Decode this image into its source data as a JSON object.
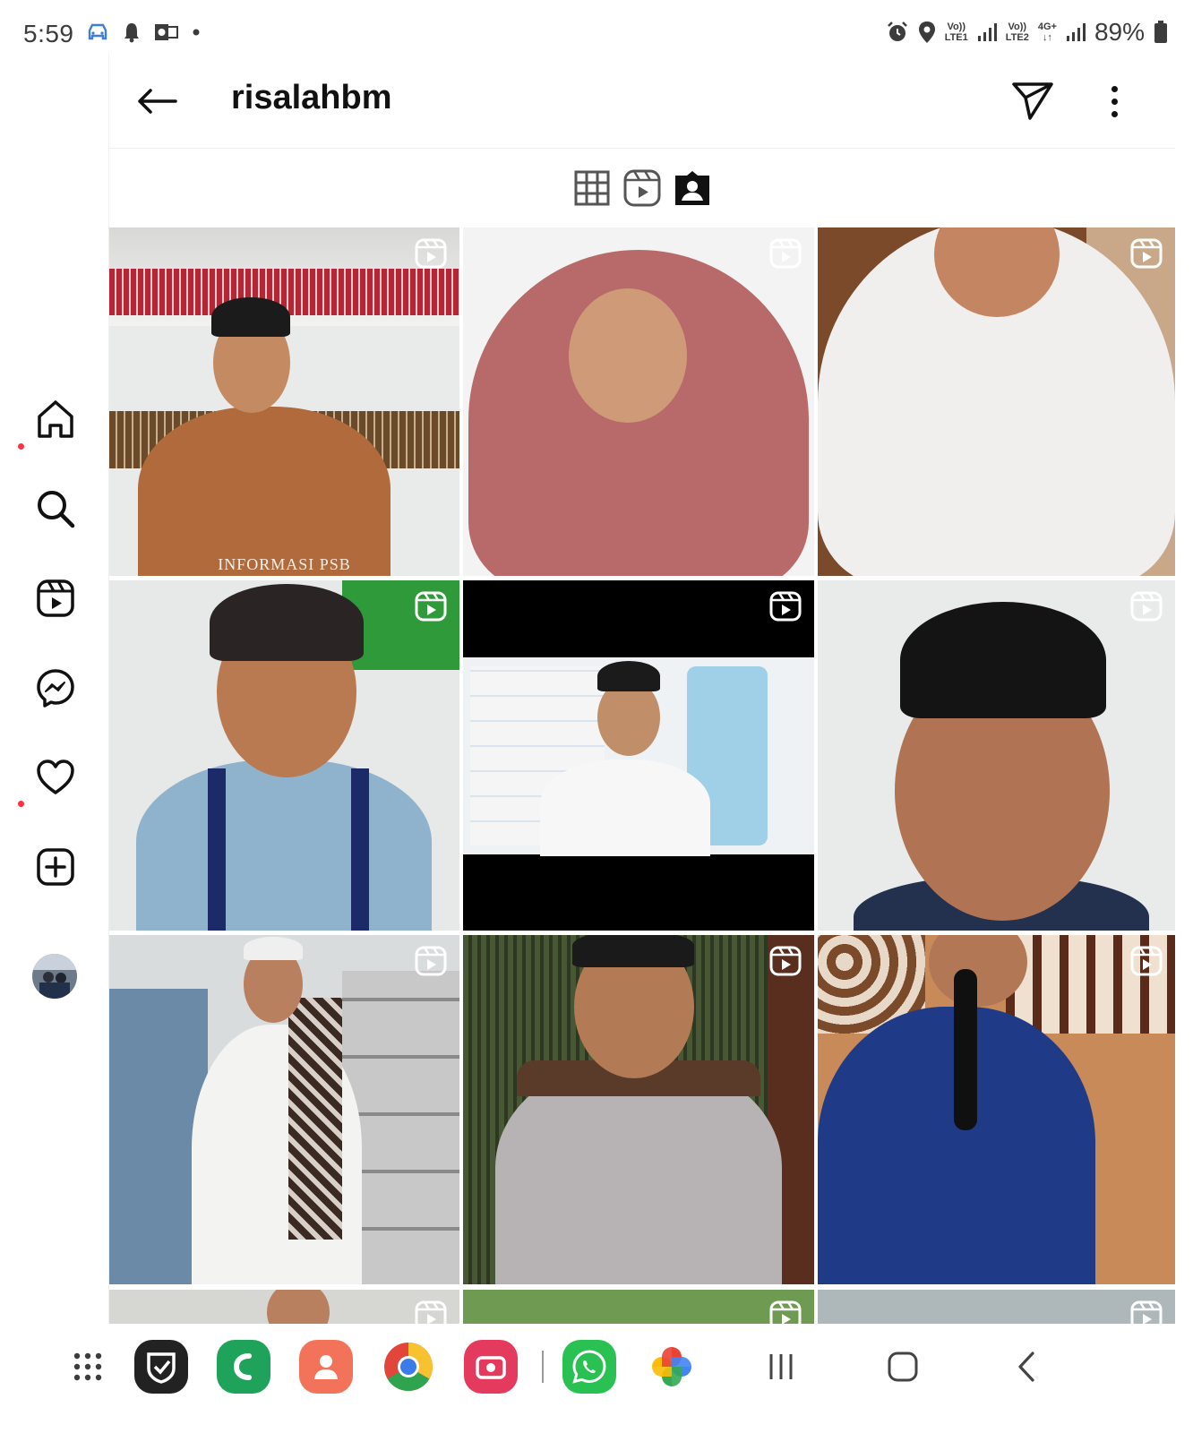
{
  "status_bar": {
    "time": "5:59",
    "left_icons": [
      "car-icon",
      "notification-bell-icon",
      "outlook-icon",
      "dot-icon"
    ],
    "right_icons": [
      "alarm-icon",
      "location-icon"
    ],
    "sim1_label_top": "Vo))",
    "sim1_label_bottom": "LTE1",
    "sim2_label_top": "Vo))",
    "sim2_label_bottom": "LTE2",
    "data_label_top": "4G+",
    "data_label_bottom": "↓↑",
    "battery": "89%"
  },
  "nav_rail": {
    "items": [
      "home-icon",
      "search-icon",
      "reels-icon",
      "messenger-icon",
      "activity-heart-icon",
      "create-icon",
      "profile-avatar"
    ]
  },
  "header": {
    "username": "risalahbm",
    "back_icon": "arrow-left-icon",
    "send_icon": "send-icon",
    "more_icon": "more-vertical-icon"
  },
  "tabs": [
    "grid-tab",
    "reels-tab",
    "tagged-tab"
  ],
  "grid": {
    "cells": [
      {
        "caption": "INFORMASI PSB"
      }
    ]
  },
  "dock": {
    "apps": [
      "app-drawer-icon",
      "shield-app",
      "phone-green-app",
      "contacts-app",
      "chrome-app",
      "screen-recorder-app",
      "whatsapp-app",
      "google-photos-app"
    ],
    "nav_keys": [
      "recents-key",
      "home-key",
      "back-key"
    ]
  },
  "colors": {
    "notification_dot": "#ff3040",
    "text_primary": "#111111",
    "divider": "#efefef"
  }
}
